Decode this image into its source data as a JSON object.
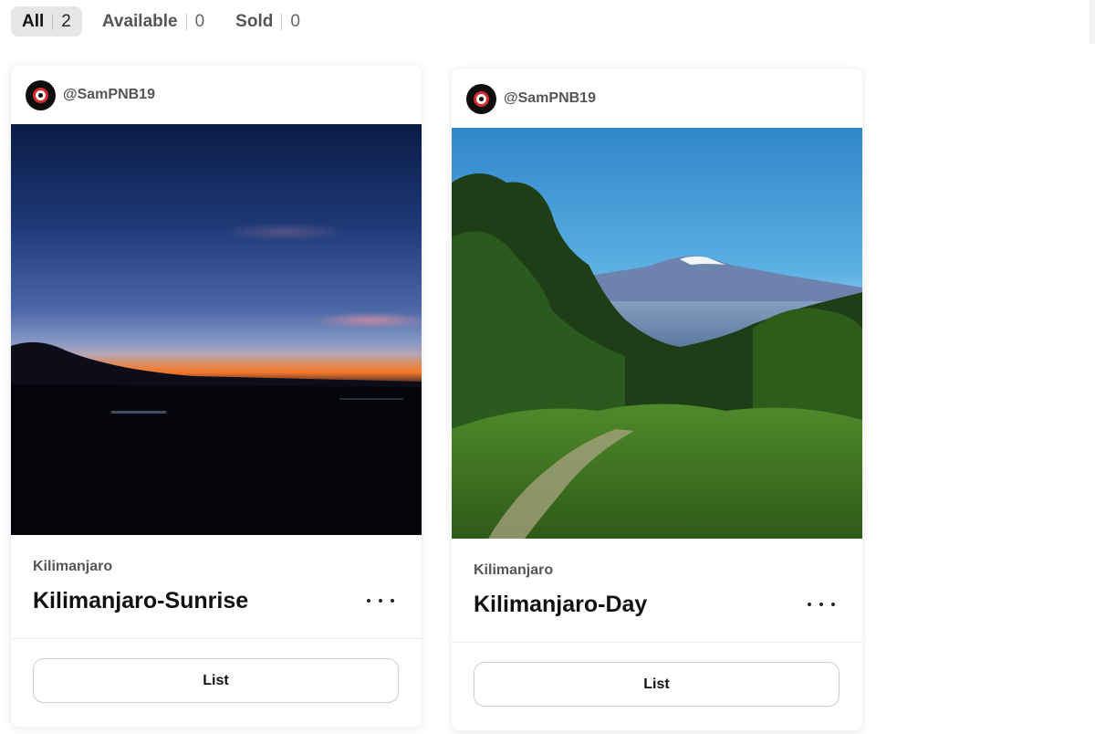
{
  "filters": [
    {
      "label": "All",
      "count": "2"
    },
    {
      "label": "Available",
      "count": "0"
    },
    {
      "label": "Sold",
      "count": "0"
    }
  ],
  "cards": [
    {
      "creator": "@SamPNB19",
      "image": "kilimanjaro-sunrise-photo",
      "collection": "Kilimanjaro",
      "title": "Kilimanjaro-Sunrise",
      "action_label": "List"
    },
    {
      "creator": "@SamPNB19",
      "image": "kilimanjaro-day-photo",
      "collection": "Kilimanjaro",
      "title": "Kilimanjaro-Day",
      "action_label": "List"
    }
  ],
  "colors": {
    "active_tab_bg": "#e6e6e6",
    "avatar_ring": "#d62a2a"
  }
}
